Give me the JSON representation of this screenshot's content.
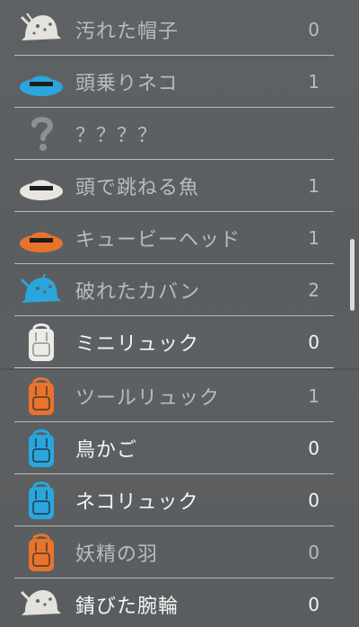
{
  "items": [
    {
      "name": "汚れた帽子",
      "count": "0",
      "icon": "dirty-hat-icon",
      "color": "#e4e2dc",
      "bright": false
    },
    {
      "name": "頭乗りネコ",
      "count": "1",
      "icon": "blue-hat-icon",
      "color": "#2aa6dc",
      "bright": false
    },
    {
      "name": "？？？？",
      "count": "",
      "icon": "unknown-question-icon",
      "color": "#8d8f90",
      "bright": false
    },
    {
      "name": "頭で跳ねる魚",
      "count": "1",
      "icon": "white-hat-icon",
      "color": "#e8e6e0",
      "bright": false
    },
    {
      "name": "キュービーヘッド",
      "count": "1",
      "icon": "orange-hat-icon",
      "color": "#e8732c",
      "bright": false
    },
    {
      "name": "破れたカバン",
      "count": "2",
      "icon": "torn-bag-icon",
      "color": "#2aa6dc",
      "bright": false
    },
    {
      "name": "ミニリュック",
      "count": "0",
      "icon": "white-backpack-icon",
      "color": "#ecebe6",
      "bright": true
    },
    {
      "name": "ツールリュック",
      "count": "1",
      "icon": "orange-backpack-icon",
      "color": "#e8732c",
      "bright": false
    },
    {
      "name": "鳥かご",
      "count": "0",
      "icon": "blue-backpack-icon",
      "color": "#2aa6dc",
      "bright": true
    },
    {
      "name": "ネコリュック",
      "count": "0",
      "icon": "blue-backpack-icon",
      "color": "#2aa6dc",
      "bright": true
    },
    {
      "name": "妖精の羽",
      "count": "0",
      "icon": "orange-backpack-icon",
      "color": "#e8732c",
      "bright": false
    },
    {
      "name": "錆びた腕輪",
      "count": "0",
      "icon": "rusty-bracelet-icon",
      "color": "#e4e2dc",
      "bright": true
    }
  ]
}
